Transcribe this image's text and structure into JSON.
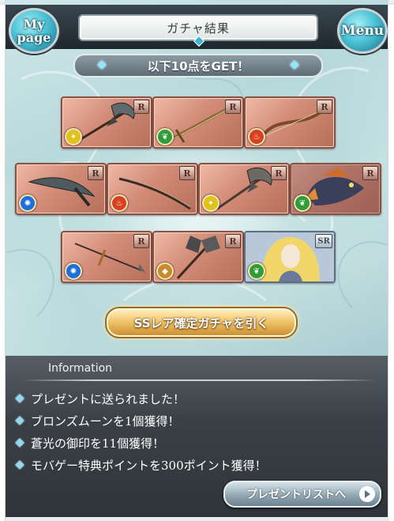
{
  "header": {
    "title": "ガチャ結果",
    "mypage_label": "My\npage",
    "menu_label": "Menu"
  },
  "banner": {
    "text": "以下10点をGET！"
  },
  "cards": [
    {
      "rarity": "R",
      "element": "wind",
      "element_color": "#e0c21a",
      "item": "axe",
      "symbol": "✦"
    },
    {
      "rarity": "R",
      "element": "earth",
      "element_color": "#2f9e3a",
      "item": "sword",
      "symbol": "❦"
    },
    {
      "rarity": "R",
      "element": "fire",
      "element_color": "#d8401f",
      "item": "bow",
      "symbol": "♨"
    },
    {
      "rarity": "R",
      "element": "water",
      "element_color": "#1e6fd8",
      "item": "scythe-blade",
      "symbol": "✺"
    },
    {
      "rarity": "R",
      "element": "fire",
      "element_color": "#d8401f",
      "item": "katana",
      "symbol": "♨"
    },
    {
      "rarity": "R",
      "element": "wind",
      "element_color": "#e0c21a",
      "item": "axe",
      "symbol": "✦"
    },
    {
      "rarity": "R",
      "element": "earth",
      "element_color": "#2f9e3a",
      "item": "summon-creature",
      "symbol": "❦"
    },
    {
      "rarity": "R",
      "element": "water",
      "element_color": "#1e6fd8",
      "item": "spear",
      "symbol": "✺"
    },
    {
      "rarity": "R",
      "element": "light",
      "element_color": "#c88a2a",
      "item": "battle-axe",
      "symbol": "◆"
    },
    {
      "rarity": "SR",
      "element": "earth",
      "element_color": "#2f9e3a",
      "item": "summon-portrait",
      "symbol": "❦"
    }
  ],
  "ss_button": {
    "label": "SSレア確定ガチャを引く"
  },
  "information": {
    "title": "Information",
    "items": [
      "プレゼントに送られました！",
      "ブロンズムーンを1個獲得！",
      "蒼光の御印を11個獲得！",
      "モバゲー特典ポイントを300ポイント獲得！"
    ],
    "present_button_label": "プレゼントリストへ"
  }
}
